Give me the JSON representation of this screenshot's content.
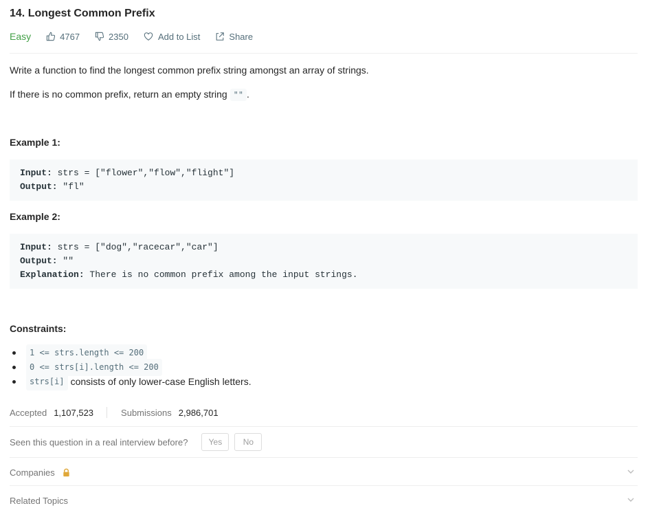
{
  "problem": {
    "title": "14. Longest Common Prefix",
    "difficulty": "Easy",
    "likes": "4767",
    "dislikes": "2350",
    "add_to_list": "Add to List",
    "share": "Share"
  },
  "description": {
    "p1": "Write a function to find the longest common prefix string amongst an array of strings.",
    "p2_before": "If there is no common prefix, return an empty string",
    "p2_code": "\"\"",
    "p2_after": "."
  },
  "examples": [
    {
      "heading": "Example 1:",
      "input_label": "Input:",
      "input_value": " strs = [\"flower\",\"flow\",\"flight\"]",
      "output_label": "Output:",
      "output_value": " \"fl\""
    },
    {
      "heading": "Example 2:",
      "input_label": "Input:",
      "input_value": " strs = [\"dog\",\"racecar\",\"car\"]",
      "output_label": "Output:",
      "output_value": " \"\"",
      "explanation_label": "Explanation:",
      "explanation_value": " There is no common prefix among the input strings."
    }
  ],
  "constraints": {
    "heading": "Constraints:",
    "items": [
      {
        "code": "1 <= strs.length <= 200",
        "text": ""
      },
      {
        "code": "0 <= strs[i].length <= 200",
        "text": ""
      },
      {
        "code": "strs[i]",
        "text": "consists of only lower-case English letters."
      }
    ]
  },
  "stats": {
    "accepted_label": "Accepted",
    "accepted_value": "1,107,523",
    "submissions_label": "Submissions",
    "submissions_value": "2,986,701"
  },
  "interview": {
    "question": "Seen this question in a real interview before?",
    "yes": "Yes",
    "no": "No"
  },
  "sections": {
    "companies": "Companies",
    "related_topics": "Related Topics"
  },
  "colors": {
    "easy": "#43a047",
    "lock": "#e0a83a",
    "code_bg": "#f7f9fa"
  }
}
